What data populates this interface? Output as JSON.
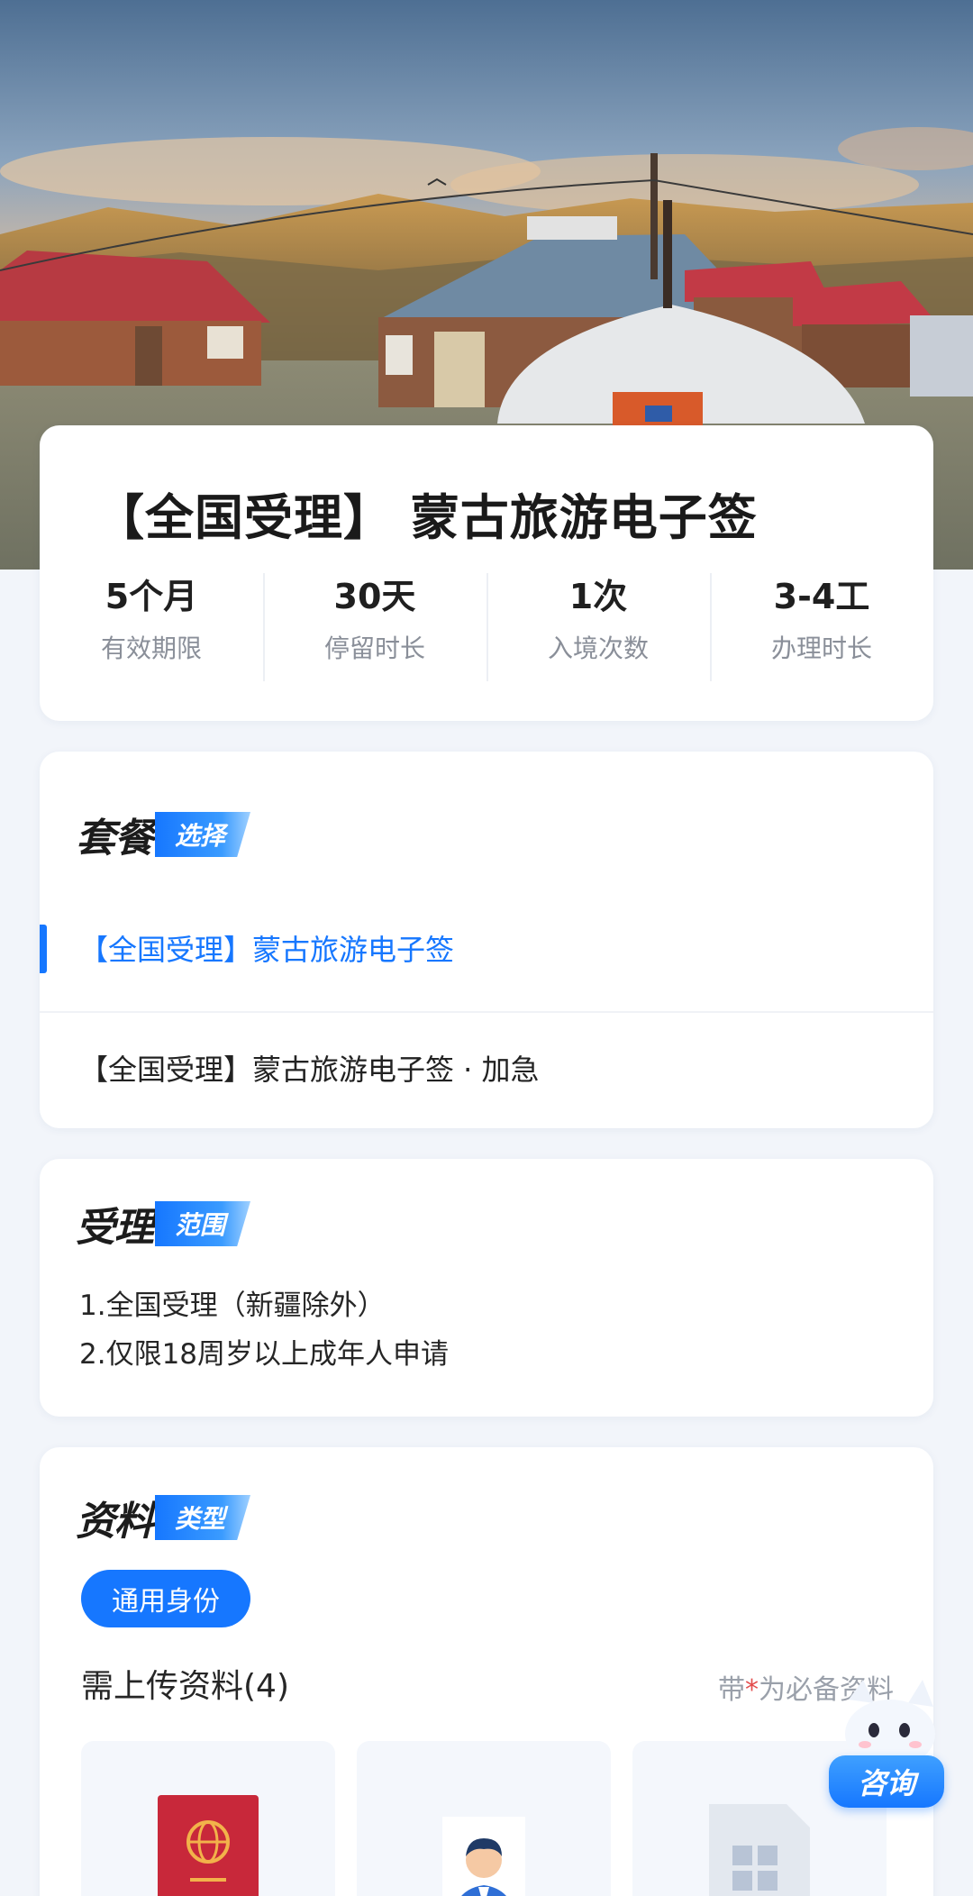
{
  "hero": {
    "alt_scene": "yurt-landscape"
  },
  "title_card": {
    "title": "【全国受理】 蒙古旅游电子签",
    "stats": [
      {
        "value": "5个月",
        "label": "有效期限"
      },
      {
        "value": "30天",
        "label": "停留时长"
      },
      {
        "value": "1次",
        "label": "入境次数"
      },
      {
        "value": "3-4工",
        "label": "办理时长"
      }
    ]
  },
  "package": {
    "heading": "套餐",
    "tag": "选择",
    "options": [
      "【全国受理】蒙古旅游电子签",
      "【全国受理】蒙古旅游电子签 · 加急"
    ]
  },
  "scope": {
    "heading": "受理",
    "tag": "范围",
    "lines": [
      "1.全国受理（新疆除外）",
      "2.仅限18周岁以上成年人申请"
    ]
  },
  "materials": {
    "heading": "资料",
    "tag": "类型",
    "identity_pill": "通用身份",
    "need_title": "需上传资料(4)",
    "note_prefix": "带",
    "note_star": "*",
    "note_suffix": "为必备资料",
    "tiles": [
      "passport-icon",
      "id-photo-icon",
      "document-icon"
    ]
  },
  "consult": {
    "label": "咨询"
  },
  "colors": {
    "accent": "#1677ff",
    "passport": "#c8283a",
    "star": "#e34d4d"
  }
}
